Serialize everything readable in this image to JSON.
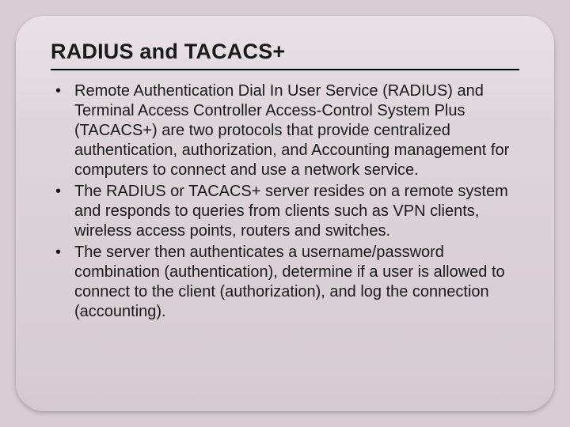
{
  "slide": {
    "title": "RADIUS and TACACS+",
    "bullets": [
      "Remote Authentication Dial In User Service (RADIUS) and Terminal Access Controller Access-Control System Plus (TACACS+) are two protocols that provide centralized authentication, authorization, and Accounting management for computers to connect and use a network service.",
      "The RADIUS or TACACS+ server resides on a remote system and responds to queries from clients such as VPN clients, wireless access points, routers and switches.",
      "The server then authenticates a username/password combination (authentication), determine if a user is allowed to connect to the client (authorization), and log the connection (accounting)."
    ]
  }
}
